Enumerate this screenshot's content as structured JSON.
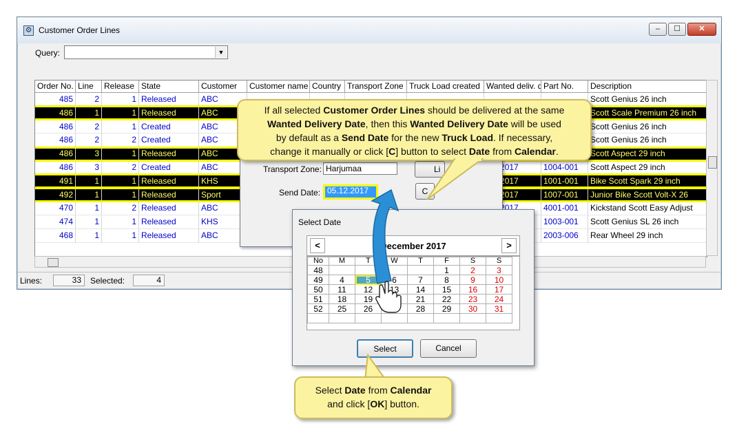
{
  "window": {
    "title": "Customer Order Lines",
    "query_label": "Query:",
    "query_value": "",
    "controls": {
      "minimize": "–",
      "maximize": "☐",
      "close": "✕"
    }
  },
  "grid": {
    "columns": [
      "Order No.",
      "Line",
      "Release",
      "State",
      "Customer",
      "Customer name",
      "Country",
      "Transport Zone",
      "Truck Load created",
      "Wanted deliv. d",
      "Part No.",
      "Description"
    ],
    "rows": [
      {
        "order": "485",
        "line": "2",
        "release": "1",
        "state": "Released",
        "customer": "ABC",
        "wanted": "",
        "part": "",
        "desc": "Scott Genius 26 inch",
        "selected": false
      },
      {
        "order": "486",
        "line": "1",
        "release": "1",
        "state": "Released",
        "customer": "ABC",
        "wanted": "",
        "part": "",
        "desc": "Scott Scale Premium 26 inch",
        "selected": true
      },
      {
        "order": "486",
        "line": "2",
        "release": "1",
        "state": "Created",
        "customer": "ABC",
        "wanted": "",
        "part": "",
        "desc": "Scott Genius 26 inch",
        "selected": false
      },
      {
        "order": "486",
        "line": "2",
        "release": "2",
        "state": "Created",
        "customer": "ABC",
        "wanted": "",
        "part": "",
        "desc": "Scott Genius 26 inch",
        "selected": false
      },
      {
        "order": "486",
        "line": "3",
        "release": "1",
        "state": "Released",
        "customer": "ABC",
        "wanted": "",
        "part": "",
        "desc": "Scott Aspect 29 inch",
        "selected": true
      },
      {
        "order": "486",
        "line": "3",
        "release": "2",
        "state": "Created",
        "customer": "ABC",
        "wanted": ".12.2017",
        "part": "1004-001",
        "desc": "Scott Aspect 29 inch",
        "selected": false
      },
      {
        "order": "491",
        "line": "1",
        "release": "1",
        "state": "Released",
        "customer": "KHS",
        "wanted": ".12.2017",
        "part": "1001-001",
        "desc": "Bike Scott Spark 29 inch",
        "selected": true
      },
      {
        "order": "492",
        "line": "1",
        "release": "1",
        "state": "Released",
        "customer": "Sport",
        "wanted": ".12.2017",
        "part": "1007-001",
        "desc": "Junior Bike Scott Volt-X 26",
        "selected": true
      },
      {
        "order": "470",
        "line": "1",
        "release": "2",
        "state": "Released",
        "customer": "ABC",
        "wanted": ".10.2017",
        "part": "4001-001",
        "desc": "Kickstand Scott Easy Adjust",
        "selected": false
      },
      {
        "order": "474",
        "line": "1",
        "release": "1",
        "state": "Released",
        "customer": "KHS",
        "wanted": "",
        "part": "1003-001",
        "desc": "Scott Genius SL 26 inch",
        "selected": false
      },
      {
        "order": "468",
        "line": "1",
        "release": "1",
        "state": "Released",
        "customer": "ABC",
        "wanted": "",
        "part": "2003-006",
        "desc": "Rear Wheel 29 inch",
        "selected": false
      }
    ]
  },
  "status": {
    "lines_label": "Lines:",
    "lines_value": "33",
    "selected_label": "Selected:",
    "selected_value": "4"
  },
  "inner_dialog": {
    "transport_zone_label": "Transport Zone:",
    "transport_zone_value": "Harjumaa",
    "send_date_label": "Send Date:",
    "send_date_value": "05.12.2017",
    "list_button": "Li",
    "calendar_button": "C"
  },
  "callout_top": {
    "p1": "If all selected ",
    "b1": "Customer Order Lines",
    "p2": " should be delivered at the same",
    "b2": "Wanted Delivery Date",
    "p3": ", then this ",
    "b3": "Wanted Delivery Date",
    "p4": " will be used",
    "p5": "by default as a ",
    "b4": "Send Date",
    "p6": " for the new ",
    "b5": "Truck Load",
    "p7": ".  If necessary,",
    "p8": "change it manually or click [",
    "b6": "C",
    "p9": "] button to select ",
    "b7": "Date",
    "p10": " from ",
    "b8": "Calendar",
    "p11": "."
  },
  "callout_bottom": {
    "p1": "Select ",
    "b1": "Date",
    "p2": " from ",
    "b2": "Calendar",
    "p3": "and click [",
    "b3": "OK",
    "p4": "] button."
  },
  "select_date": {
    "title": "Select Date",
    "month": "December 2017",
    "prev": "<",
    "next": ">",
    "headers": [
      "No",
      "M",
      "T",
      "W",
      "T",
      "F",
      "S",
      "S"
    ],
    "weeks": [
      [
        "48",
        "",
        "",
        "",
        "",
        "1",
        "2",
        "3"
      ],
      [
        "49",
        "4",
        "5",
        "6",
        "7",
        "8",
        "9",
        "10"
      ],
      [
        "50",
        "11",
        "12",
        "13",
        "14",
        "15",
        "16",
        "17"
      ],
      [
        "51",
        "18",
        "19",
        "20",
        "21",
        "22",
        "23",
        "24"
      ],
      [
        "52",
        "25",
        "26",
        "27",
        "28",
        "29",
        "30",
        "31"
      ]
    ],
    "selected_day": "5",
    "select_button": "Select",
    "cancel_button": "Cancel"
  },
  "colors": {
    "selection_highlight": "#f4f700",
    "callout_bg": "#fcf3a1",
    "link_blue": "#0000cc"
  }
}
